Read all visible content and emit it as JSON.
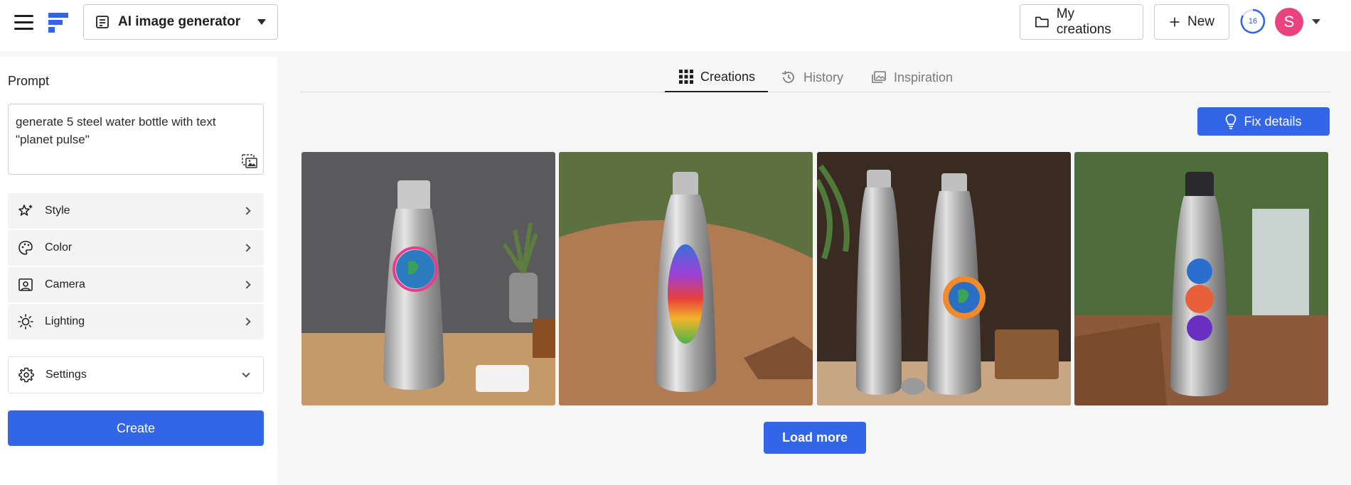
{
  "header": {
    "menu_icon": "hamburger-icon",
    "logo_icon": "brand-logo-icon",
    "tool_selector": {
      "label": "AI image generator",
      "icon": "document-list-icon"
    },
    "my_creations_label": "My creations",
    "new_label": "New",
    "credits": "16",
    "avatar_initial": "S",
    "colors": {
      "accent": "#3366e6",
      "avatar": "#e8437f"
    }
  },
  "sidebar": {
    "prompt_label": "Prompt",
    "prompt_line1": "generate 5  steel water bottle with text",
    "prompt_line2": "\"planet pulse\"",
    "options": [
      {
        "label": "Style",
        "icon": "sparkle-star-icon"
      },
      {
        "label": "Color",
        "icon": "palette-icon"
      },
      {
        "label": "Camera",
        "icon": "camera-frame-icon"
      },
      {
        "label": "Lighting",
        "icon": "sun-icon"
      }
    ],
    "settings_label": "Settings",
    "create_label": "Create"
  },
  "main": {
    "tabs": [
      {
        "label": "Creations",
        "icon": "grid-icon",
        "active": true
      },
      {
        "label": "History",
        "icon": "history-icon",
        "active": false
      },
      {
        "label": "Inspiration",
        "icon": "images-icon",
        "active": false
      }
    ],
    "fix_details_label": "Fix details",
    "gallery": [
      {
        "icon": "bottle-image-1"
      },
      {
        "icon": "bottle-image-2"
      },
      {
        "icon": "bottle-image-3"
      },
      {
        "icon": "bottle-image-4"
      }
    ],
    "load_more_label": "Load more"
  }
}
